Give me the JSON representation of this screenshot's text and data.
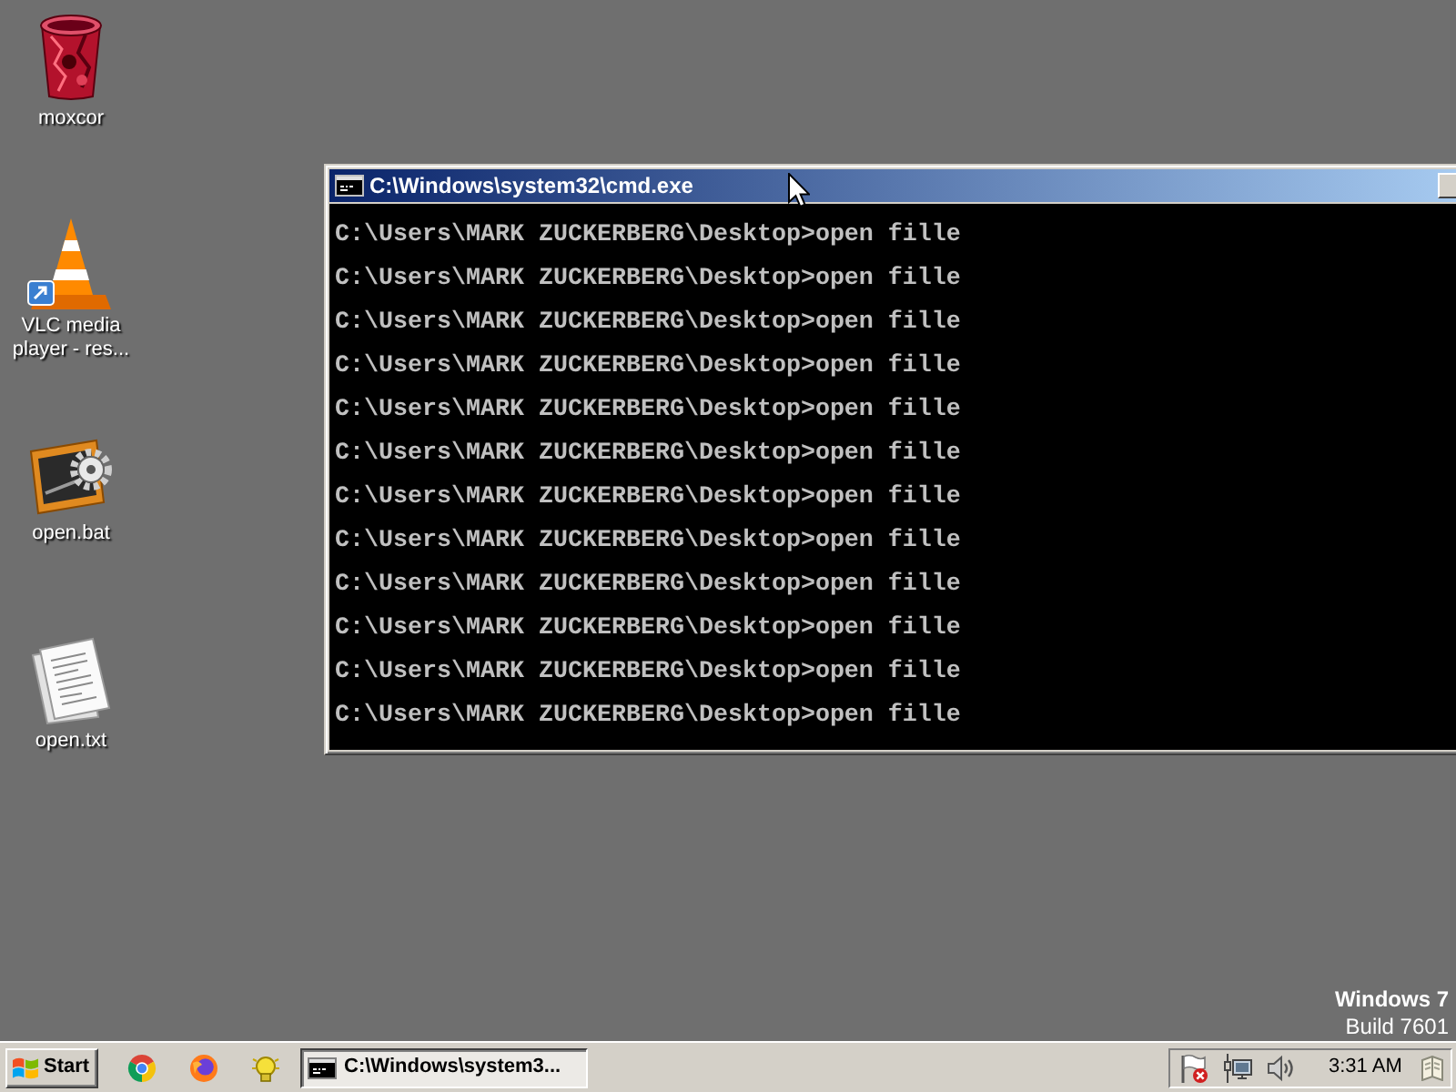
{
  "desktop_icons": [
    {
      "label": "moxcor",
      "kind": "recycle-bin"
    },
    {
      "label": "VLC media player - res...",
      "kind": "media-player"
    },
    {
      "label": "open.bat",
      "kind": "batch-file"
    },
    {
      "label": "open.txt",
      "kind": "text-file"
    }
  ],
  "console_window": {
    "title": "C:\\Windows\\system32\\cmd.exe",
    "lines": [
      "C:\\Users\\MARK ZUCKERBERG\\Desktop>open fille",
      "C:\\Users\\MARK ZUCKERBERG\\Desktop>open fille",
      "C:\\Users\\MARK ZUCKERBERG\\Desktop>open fille",
      "C:\\Users\\MARK ZUCKERBERG\\Desktop>open fille",
      "C:\\Users\\MARK ZUCKERBERG\\Desktop>open fille",
      "C:\\Users\\MARK ZUCKERBERG\\Desktop>open fille",
      "C:\\Users\\MARK ZUCKERBERG\\Desktop>open fille",
      "C:\\Users\\MARK ZUCKERBERG\\Desktop>open fille",
      "C:\\Users\\MARK ZUCKERBERG\\Desktop>open fille",
      "C:\\Users\\MARK ZUCKERBERG\\Desktop>open fille",
      "C:\\Users\\MARK ZUCKERBERG\\Desktop>open fille",
      "C:\\Users\\MARK ZUCKERBERG\\Desktop>open fille"
    ]
  },
  "os_watermark": {
    "edition": "Windows 7",
    "build": "Build 7601"
  },
  "taskbar": {
    "start_label": "Start",
    "quick_launch": [
      {
        "kind": "chrome"
      },
      {
        "kind": "firefox"
      },
      {
        "kind": "bulb"
      }
    ],
    "tasks": [
      {
        "label": "C:\\Windows\\system3...",
        "selected": true
      }
    ],
    "tray_icons": [
      {
        "kind": "flag-alert"
      },
      {
        "kind": "network"
      },
      {
        "kind": "volume"
      }
    ],
    "clock": "3:31 AM"
  }
}
